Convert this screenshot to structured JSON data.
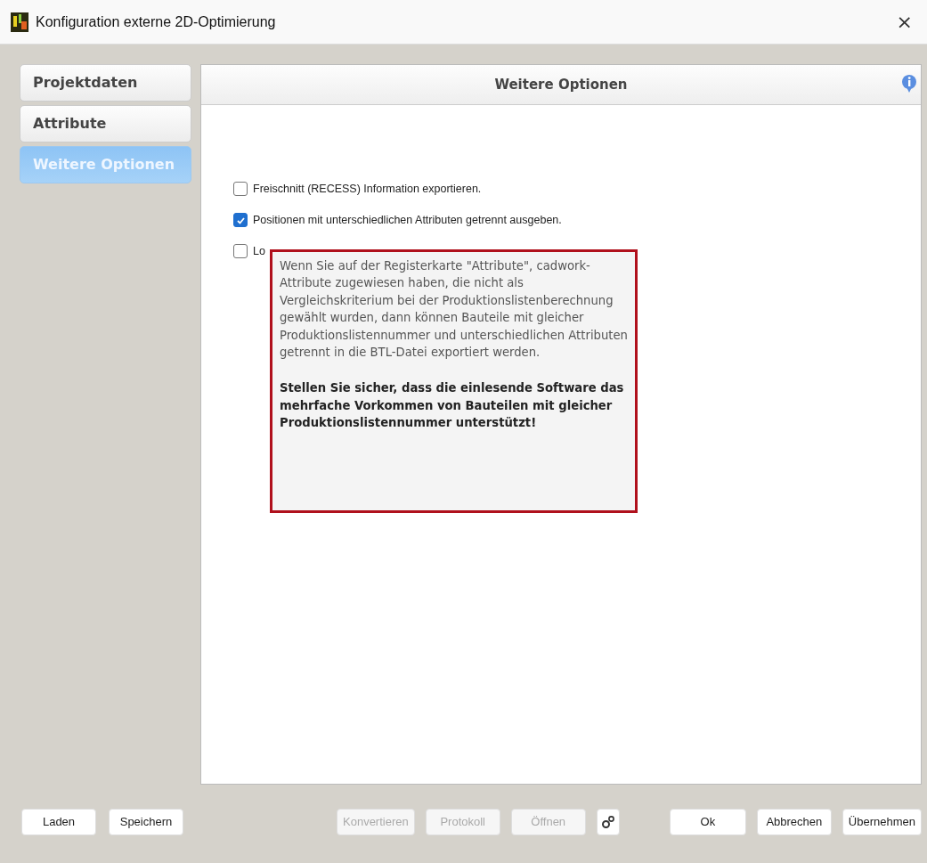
{
  "window": {
    "title": "Konfiguration externe 2D-Optimierung",
    "close": "×"
  },
  "tabs": [
    {
      "label": "Projektdaten",
      "selected": false
    },
    {
      "label": "Attribute",
      "selected": false
    },
    {
      "label": "Weitere Optionen",
      "selected": true
    }
  ],
  "panel": {
    "title": "Weitere Optionen"
  },
  "options": [
    {
      "label": "Freischnitt (RECESS) Information exportieren.",
      "checked": false
    },
    {
      "label": "Positionen mit unterschiedlichen Attributen getrennt ausgeben.",
      "checked": true
    },
    {
      "label": "Lo",
      "checked": false
    }
  ],
  "tooltip": {
    "paragraphs": [
      {
        "text": "Wenn Sie auf der Registerkarte \"Attribute\", cadwork-Attribute zugewiesen haben, die nicht als Vergleichskriterium bei der Produktionslistenberechnung gewählt wurden, dann können Bauteile mit gleicher Produktionslistennummer und unterschiedlichen Attributen getrennt in die BTL-Datei exportiert werden.",
        "bold": false
      },
      {
        "text": "Stellen Sie sicher, dass die einlesende Software das mehrfache Vorkommen von Bauteilen mit gleicher Produktionslistennummer unterstützt!",
        "bold": true
      }
    ]
  },
  "footer": {
    "left_buttons": [
      {
        "label": "Laden",
        "disabled": false
      },
      {
        "label": "Speichern",
        "disabled": false
      }
    ],
    "middle_buttons": [
      {
        "label": "Konvertieren",
        "disabled": true
      },
      {
        "label": "Protokoll",
        "disabled": true
      },
      {
        "label": "Öffnen",
        "disabled": true
      }
    ],
    "right_buttons": [
      {
        "label": "Ok",
        "disabled": false
      },
      {
        "label": "Abbrechen",
        "disabled": false
      },
      {
        "label": "Übernehmen",
        "disabled": false
      }
    ]
  }
}
